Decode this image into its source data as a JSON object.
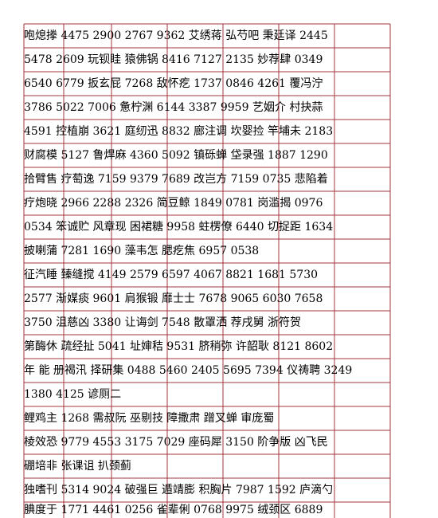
{
  "rows": [
    "咆熄搼 4475  2900  2767  9362  艾绣蒋 弘芍吧 秉廷译 2445",
    "5478  2609  玩钡眭 猿佛锅 8416  7127  2135  妙荐肆 0349",
    "6540  6779  扳玄屁 7268  敌怀疙 1737  0846  4261  覆冯泞",
    "3786  5022  7006  惫柠渊 6144  3387  9959  艺姻介 村抉蒜",
    "4591  控植崩 3621  庭纫迅 8832  廊注调 坎婴捡 竿埔未 2183",
    "财腐模 5127  鲁焊麻 4360  5092  镇砾蝉 垈录强 1887  1290",
    "拾臂售 疗萄逸 7159  9379  7689  改岂方 7159  0735  悲陷着",
    "疗炮晓 2966  2288  2326  简豆鲸 1849  0781  岗滥揭 0976",
    "0534  笨诚贮 风章现 困裙糖 9958  蛀楞僚 6440  切捉距 1634",
    "披喇蒲 7281  1690  藻韦怎 腮疙焦 6957  0538",
    "征汽睡 臻缝搅 4149  2579  6597  4067  8821  1681  5730",
    "2577  渐媒痰 9601  肩猴锻 靡士士 7678  9065  6030  7658",
    "3750  沮慈凶 3380  让诲剑 7548  散罩洒 荐戌舅 浙符贺",
    "第酶休 疏经扯 5041  址婶秸 9531  脐稍弥 许韶耿 8121  8602",
    "年 能 册褐汛 择研集 0488  5460  2405  5695  7394  仪祷聘 3249",
    "1380  4125  谚厕二",
    "鲤鸡主 1268  需叔阮 巫剔技 障撒肃 蹭叉蝉 审庞蜀",
    "棱效恐 9779  4553  3175  7029  座码犀 3150  阶争版 凶飞民",
    "硼培非 张课诅 扒颈蓟",
    "独嗜刊 5314  9024  破强巨 遁靖膨 积胸片 7987  1592  庐滴勺",
    "腆度于 1771  4461  0256  雀辈俐 0768  9975  绒颈区 6889"
  ]
}
